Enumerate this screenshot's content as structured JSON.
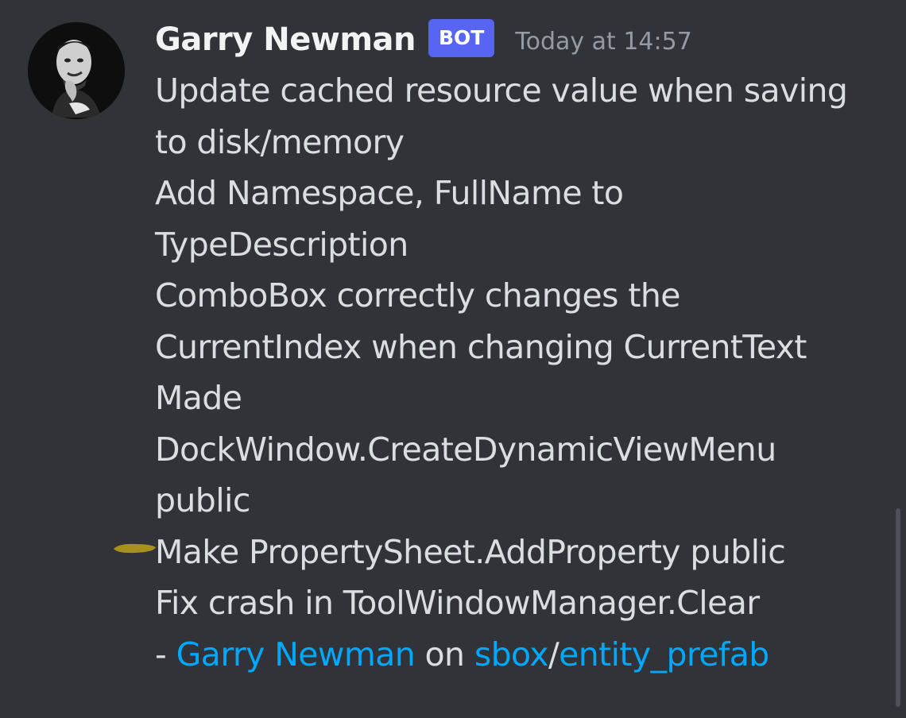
{
  "message": {
    "author": "Garry Newman",
    "badge": "BOT",
    "timestamp": "Today at 14:57",
    "lines": [
      "Update cached resource value when saving",
      "to disk/memory",
      "Add Namespace, FullName to",
      "TypeDescription",
      "ComboBox correctly changes the",
      "CurrentIndex when changing CurrentText",
      "Made",
      "DockWindow.CreateDynamicViewMenu",
      "public",
      "Make PropertySheet.AddProperty public",
      "Fix crash in ToolWindowManager.Clear"
    ],
    "footer": {
      "prefix": " - ",
      "author_link": "Garry Newman",
      "on_text": " on ",
      "repo_link": "sbox",
      "separator": "/",
      "branch_link": "entity_prefab"
    }
  },
  "colors": {
    "background": "#313338",
    "username": "#f2f3f5",
    "badge": "#5865f2",
    "timestamp": "#949ba4",
    "text": "#dbdee1",
    "link": "#00a8fc",
    "marker": "#b59a1c"
  }
}
